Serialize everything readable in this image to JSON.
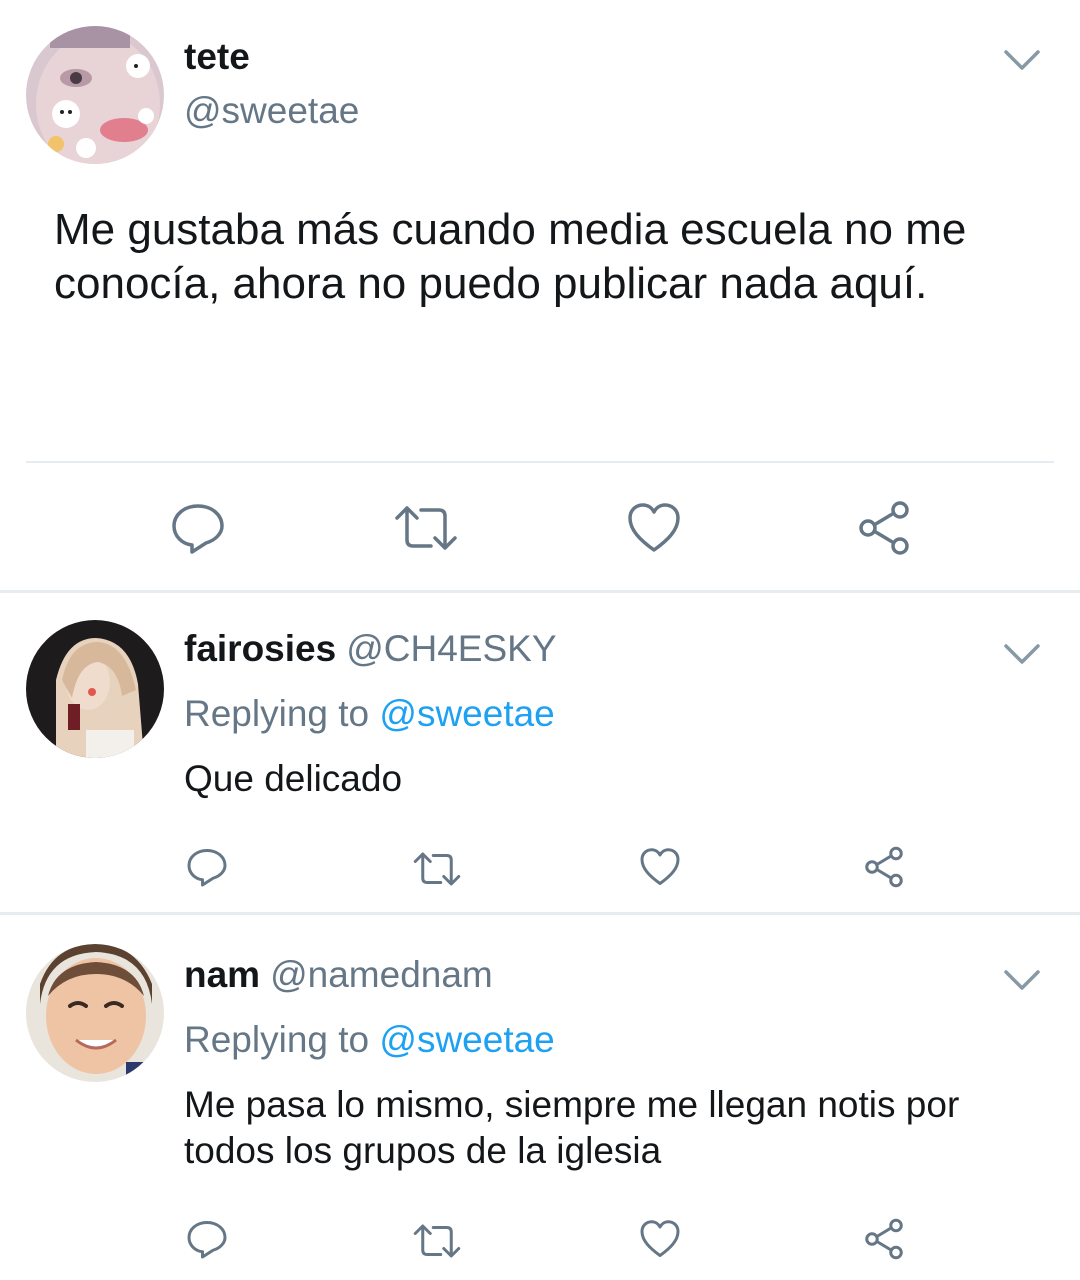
{
  "colors": {
    "text": "#14171a",
    "secondary": "#657786",
    "link": "#1da1f2",
    "divider": "#e6ecf0"
  },
  "main_tweet": {
    "name": "tete",
    "handle": "@sweetae",
    "text": "Me gustaba más cuando media escuela no me conocía, ahora no puedo publicar nada aquí.",
    "avatar_icon": "avatar-face-stickers",
    "actions": [
      "reply-icon",
      "retweet-icon",
      "like-icon",
      "share-icon"
    ]
  },
  "replies": [
    {
      "name": "fairosies",
      "handle": "@CH4ESKY",
      "replying_prefix": "Replying to ",
      "replying_to": "@sweetae",
      "text": "Que delicado",
      "avatar_icon": "avatar-blonde-woman"
    },
    {
      "name": "nam",
      "handle": "@namednam",
      "replying_prefix": "Replying to ",
      "replying_to": "@sweetae",
      "text": "Me pasa lo mismo, siempre me llegan notis por todos los grupos de la iglesia",
      "avatar_icon": "avatar-smiling-man"
    }
  ]
}
